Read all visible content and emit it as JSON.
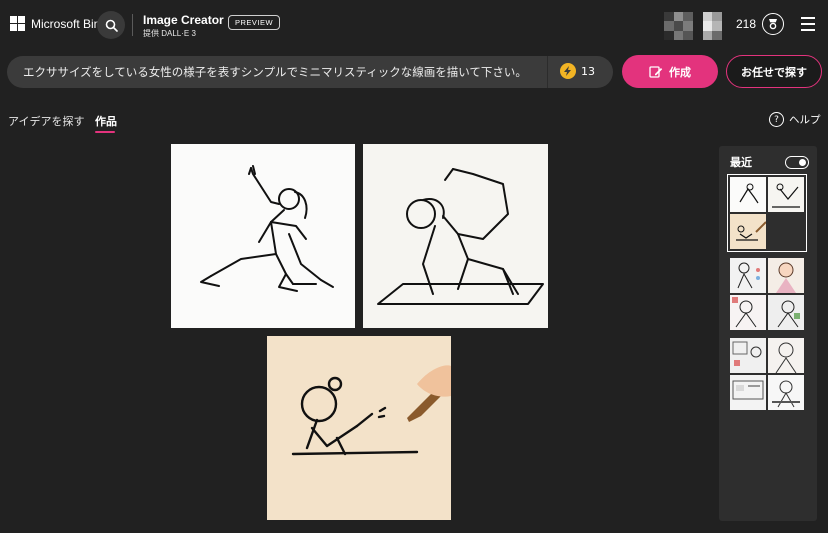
{
  "header": {
    "logo_text": "Microsoft Bing",
    "app_title": "Image Creator",
    "app_subtitle": "提供 DALL·E 3",
    "preview_badge": "PREVIEW",
    "points": "218"
  },
  "prompt": {
    "text": "エクササイズをしている女性の様子を表すシンプルでミニマリスティックな線画を描いて下さい。",
    "boost_count": "13"
  },
  "actions": {
    "create_label": "作成",
    "surprise_label": "お任せで探す"
  },
  "tabs": [
    {
      "label": "アイデアを探す",
      "active": false
    },
    {
      "label": "作品",
      "active": true
    }
  ],
  "help_label": "ヘルプ",
  "results": [
    {
      "alt": "woman stretching line art"
    },
    {
      "alt": "woman yoga pose line art"
    },
    {
      "alt": "hand drawing stick figure"
    }
  ],
  "sidebar": {
    "title": "最近",
    "toggle_on": true
  },
  "icons": {
    "search": "search-icon",
    "reward": "reward-icon",
    "menu": "hamburger-menu-icon",
    "boost": "lightning-icon",
    "create": "pencil-paper-icon",
    "help": "question-icon"
  },
  "colors": {
    "accent": "#e3337d",
    "background": "#212121",
    "boost": "#f2b424"
  }
}
